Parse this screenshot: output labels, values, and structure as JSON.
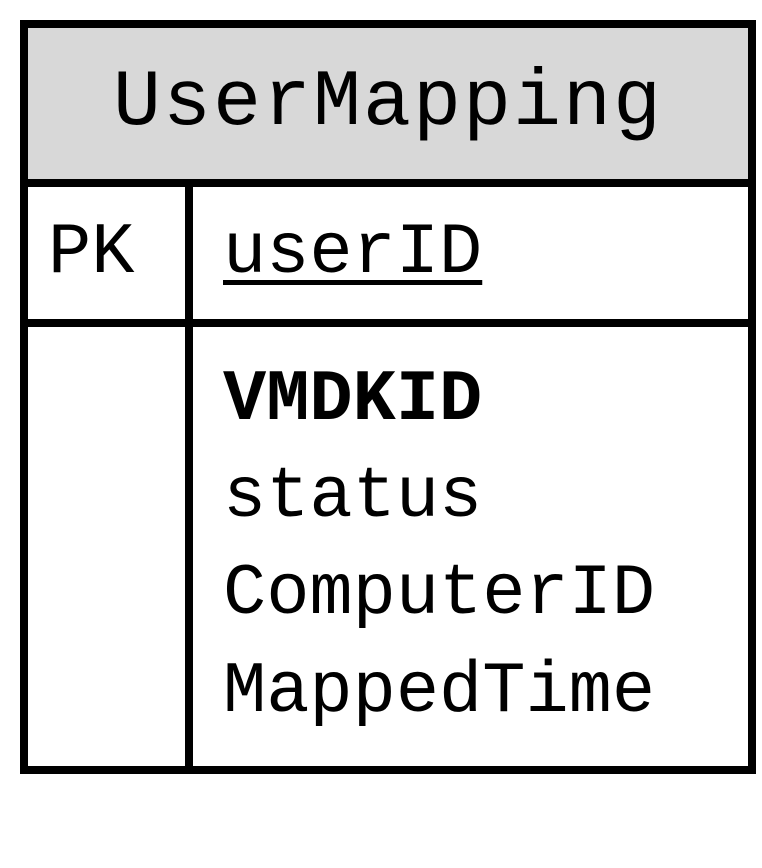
{
  "entity": {
    "title": "UserMapping",
    "pk_label": "PK",
    "pk_field": "userID",
    "attributes": [
      {
        "name": "VMDKID",
        "bold": true
      },
      {
        "name": "status",
        "bold": false
      },
      {
        "name": "ComputerID",
        "bold": false
      },
      {
        "name": "MappedTime",
        "bold": false
      }
    ]
  }
}
